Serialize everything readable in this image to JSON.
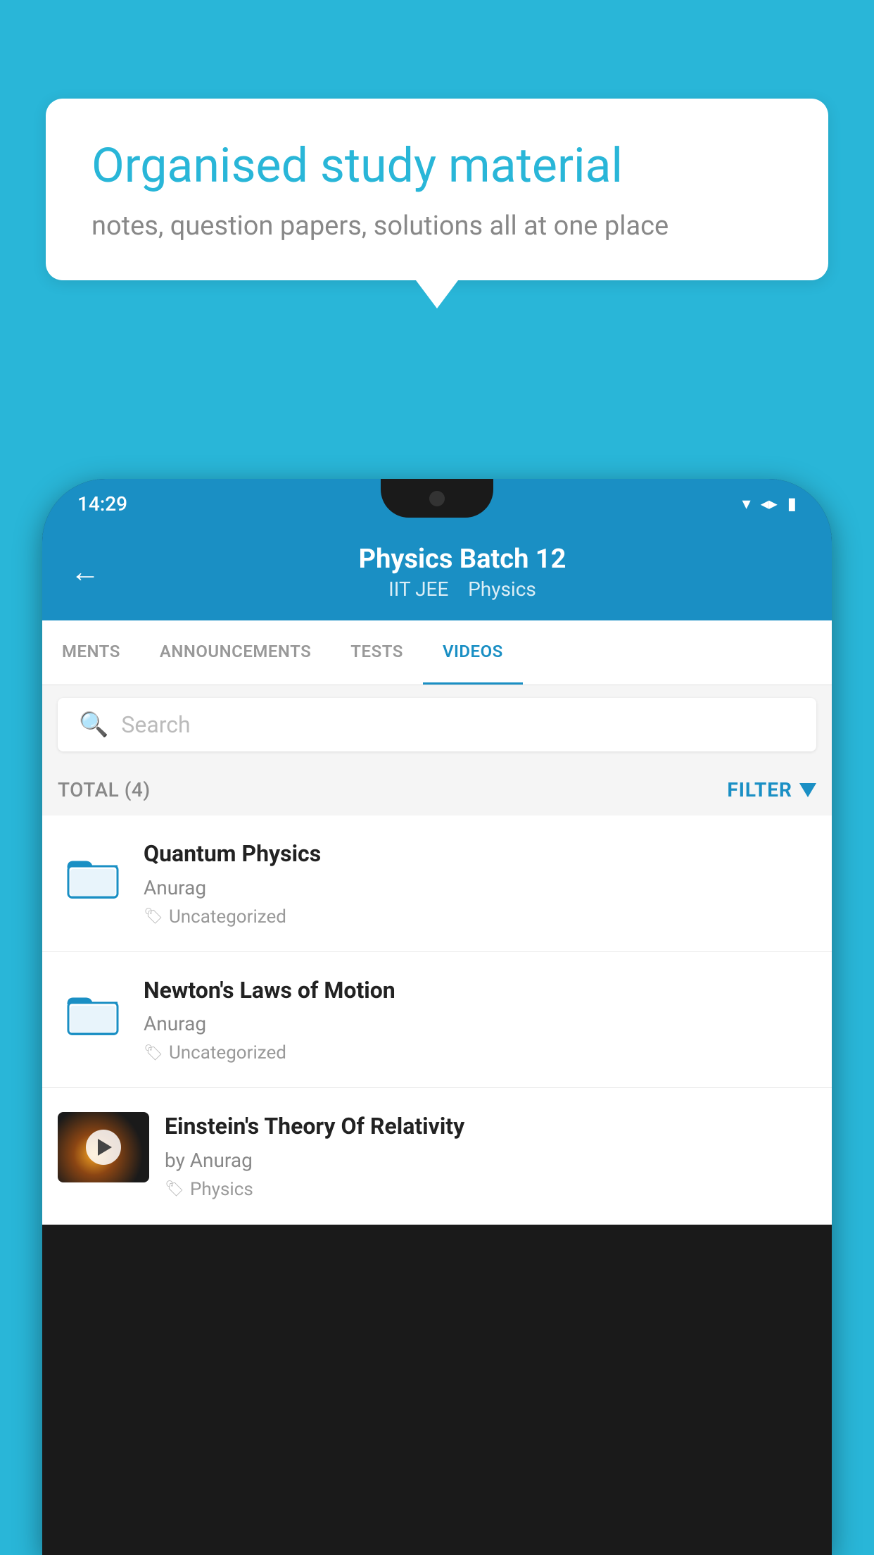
{
  "background_color": "#29b6d8",
  "speech_bubble": {
    "title": "Organised study material",
    "subtitle": "notes, question papers, solutions all at one place"
  },
  "status_bar": {
    "time": "14:29"
  },
  "app_header": {
    "back_label": "←",
    "title": "Physics Batch 12",
    "subtitle_parts": [
      "IIT JEE",
      "Physics"
    ]
  },
  "tabs": [
    {
      "label": "MENTS",
      "active": false
    },
    {
      "label": "ANNOUNCEMENTS",
      "active": false
    },
    {
      "label": "TESTS",
      "active": false
    },
    {
      "label": "VIDEOS",
      "active": true
    }
  ],
  "search": {
    "placeholder": "Search"
  },
  "filter_bar": {
    "total": "TOTAL (4)",
    "filter_label": "FILTER"
  },
  "videos": [
    {
      "id": "v1",
      "title": "Quantum Physics",
      "author": "Anurag",
      "tag": "Uncategorized",
      "type": "folder",
      "has_thumb": false
    },
    {
      "id": "v2",
      "title": "Newton's Laws of Motion",
      "author": "Anurag",
      "tag": "Uncategorized",
      "type": "folder",
      "has_thumb": false
    },
    {
      "id": "v3",
      "title": "Einstein's Theory Of Relativity",
      "author": "by Anurag",
      "tag": "Physics",
      "type": "video",
      "has_thumb": true
    }
  ]
}
